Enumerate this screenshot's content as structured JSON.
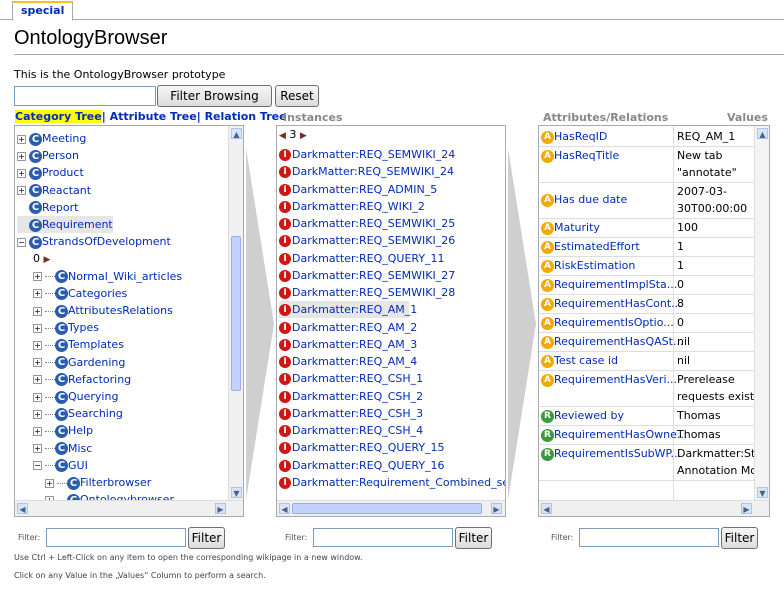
{
  "tab": {
    "label": "special"
  },
  "page": {
    "title": "OntologyBrowser",
    "intro": "This is the OntologyBrowser prototype"
  },
  "search": {
    "value": "",
    "filter_browsing_label": "Filter Browsing",
    "reset_label": "Reset"
  },
  "tree_tabs": {
    "category": "Category Tree",
    "sep1": "|",
    "attribute": " Attribute Tree",
    "sep2": "|",
    "relation": " Relation Tree"
  },
  "columns": {
    "instances": "Instances",
    "attributes": "Attributes/Relations",
    "values": "Values"
  },
  "category_tree": {
    "top_items": [
      "Meeting",
      "Person",
      "Product",
      "Reactant",
      "Report",
      "Requirement",
      "StrandsOfDevelopment"
    ],
    "pager": "0",
    "children": [
      "Normal_Wiki_articles",
      "Categories",
      "AttributesRelations",
      "Types",
      "Templates",
      "Gardening",
      "Refactoring",
      "Querying",
      "Searching",
      "Help",
      "Misc",
      "GUI"
    ],
    "grandchildren": [
      "Filterbrowser",
      "Ontologybrowser"
    ]
  },
  "instances": {
    "pager": "3",
    "items": [
      "Darkmatter:REQ_SEMWIKI_24",
      "DarkMatter:REQ_SEMWIKI_24",
      "Darkmatter:REQ_ADMIN_5",
      "Darkmatter:REQ_WIKI_2",
      "Darkmatter:REQ_SEMWIKI_25",
      "Darkmatter:REQ_SEMWIKI_26",
      "Darkmatter:REQ_QUERY_11",
      "Darkmatter:REQ_SEMWIKI_27",
      "Darkmatter:REQ_SEMWIKI_28",
      "Darkmatter:REQ_AM_1",
      "Darkmatter:REQ_AM_2",
      "Darkmatter:REQ_AM_3",
      "Darkmatter:REQ_AM_4",
      "Darkmatter:REQ_CSH_1",
      "Darkmatter:REQ_CSH_2",
      "Darkmatter:REQ_CSH_3",
      "Darkmatter:REQ_CSH_4",
      "Darkmatter:REQ_QUERY_15",
      "Darkmatter:REQ_QUERY_16",
      "Darkmatter:Requirement_Combined_sear"
    ]
  },
  "attributes": [
    {
      "icon": "A",
      "name": "HasReqID",
      "value": [
        "REQ_AM_1"
      ]
    },
    {
      "icon": "A",
      "name": "HasReqTitle",
      "value": [
        "New tab",
        "\"annotate\""
      ]
    },
    {
      "icon": "A",
      "name": "Has due date",
      "value": [
        "2007-03-",
        "30T00:00:00"
      ]
    },
    {
      "icon": "A",
      "name": "Maturity",
      "value": [
        "100"
      ]
    },
    {
      "icon": "A",
      "name": "EstimatedEffort",
      "value": [
        "1"
      ]
    },
    {
      "icon": "A",
      "name": "RiskEstimation",
      "value": [
        "1"
      ]
    },
    {
      "icon": "A",
      "name": "RequirementImplSta...",
      "value": [
        "0"
      ]
    },
    {
      "icon": "A",
      "name": "RequirementHasCont...",
      "value": [
        "8"
      ]
    },
    {
      "icon": "A",
      "name": "RequirementIsOptio...",
      "value": [
        "0"
      ]
    },
    {
      "icon": "A",
      "name": "RequirementHasQASt...",
      "value": [
        "nil"
      ]
    },
    {
      "icon": "A",
      "name": "Test case id",
      "value": [
        "nil"
      ]
    },
    {
      "icon": "A",
      "name": "RequirementHasVeri...",
      "value": [
        "Prerelease",
        "requests exists"
      ]
    },
    {
      "icon": "R",
      "name": "Reviewed by",
      "value": [
        "Thomas"
      ]
    },
    {
      "icon": "R",
      "name": "RequirementHasOwne...",
      "value": [
        "Thomas"
      ]
    },
    {
      "icon": "R",
      "name": "RequirementIsSubWP...",
      "value": [
        "Darkmatter:Strand",
        "Annotation Mode"
      ]
    }
  ],
  "filters": {
    "label": "Filter:",
    "button": "Filter"
  },
  "hints": {
    "line1": "Use Ctrl + Left-Click on any item to open the corresponding wikipage in a new window.",
    "line2": "Click on any Value in the „Values“ Column to perform a search."
  },
  "icons": {
    "category": "C",
    "instance": "I",
    "attribute": "A",
    "relation": "R"
  },
  "colors": {
    "link": "#002bb8",
    "tab_accent": "#fabd23",
    "highlight": "#ffff00",
    "instance_icon": "#d01515",
    "category_icon": "#2a5db0",
    "attribute_icon": "#f2a900",
    "relation_icon": "#3b9a3b"
  }
}
